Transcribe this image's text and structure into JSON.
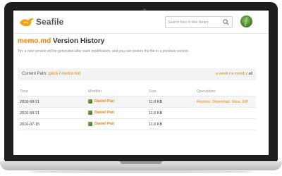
{
  "app": {
    "logo_text": "Seafile"
  },
  "search": {
    "placeholder": "Search files in this library"
  },
  "page": {
    "title_file": "memo.md",
    "title_suffix": " Version History",
    "tip": "Tip: a new version will be generated after each modification, and you can restore the file to a previous version."
  },
  "path": {
    "label": "Current Path:",
    "crumbs": [
      "quick",
      "memo.md"
    ],
    "separator": " / "
  },
  "range": {
    "options": [
      "a week",
      "a month",
      "all"
    ],
    "selected": "all"
  },
  "table": {
    "columns": [
      "Time",
      "Modifier",
      "Size",
      "Operations"
    ],
    "rows": [
      {
        "time": "2016-09-21",
        "modifier": "Daniel Pan",
        "size": "11.0 KB",
        "operations": [
          "Restore",
          "Download",
          "View",
          "Diff"
        ]
      },
      {
        "time": "2016-09-21",
        "modifier": "Daniel Pan",
        "size": "11.0 KB",
        "operations": []
      },
      {
        "time": "2016-07-15",
        "modifier": "Daniel Pan",
        "size": "11.0 KB",
        "operations": []
      }
    ]
  },
  "colors": {
    "accent": "#eb8205",
    "logo_bird": "#f2a20c"
  },
  "icons": {
    "logo": "seafile-bird-icon",
    "search": "search-icon",
    "avatar": "user-avatar"
  }
}
